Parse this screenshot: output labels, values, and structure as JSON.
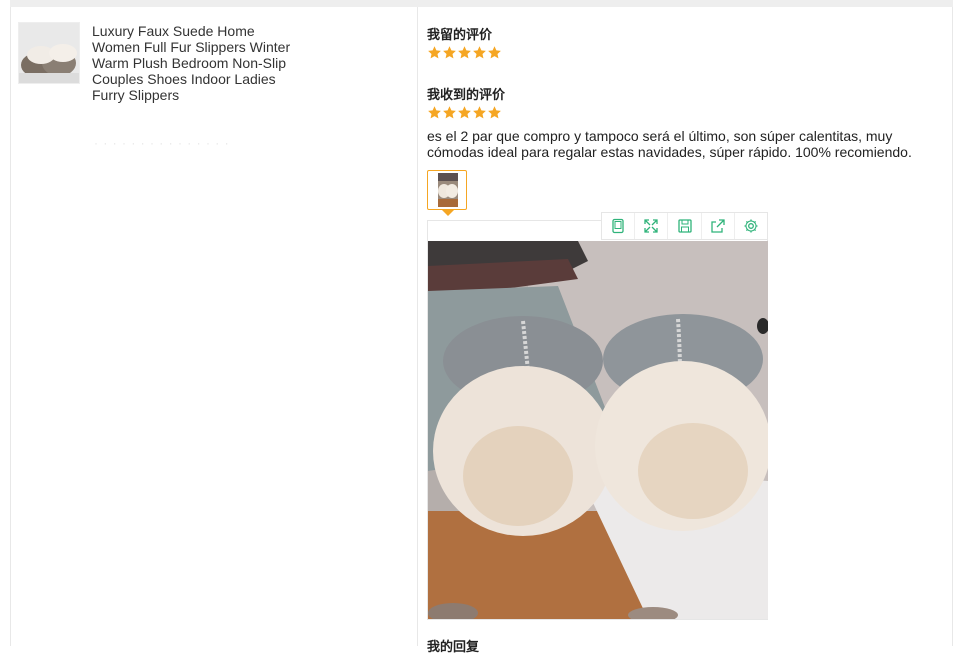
{
  "product": {
    "title": "Luxury Faux Suede Home Women Full Fur Slippers Winter Warm Plush Bedroom Non-Slip Couples Shoes Indoor Ladies Furry Slippers",
    "thumbnail_icon": "slipper-product-thumbnail",
    "faded_text": "· · · · · · · · · · · · · · ·"
  },
  "my_review": {
    "title": "我留的评价",
    "rating": 5
  },
  "received_review": {
    "title": "我收到的评价",
    "rating": 5,
    "text": "es el 2 par que compro y tampoco será el último, son súper calentitas, muy cómodas ideal para regalar estas navidades, súper rápido. 100% recomiendo."
  },
  "viewer": {
    "toolbar": [
      {
        "icon": "tablet-icon"
      },
      {
        "icon": "fullscreen-icon"
      },
      {
        "icon": "save-icon"
      },
      {
        "icon": "share-icon"
      },
      {
        "icon": "settings-icon"
      }
    ]
  },
  "reply": {
    "title": "我的回复"
  },
  "colors": {
    "star": "#f5a623",
    "toolbar_icon": "#2fb37a",
    "thumb_border": "#f5a623"
  }
}
